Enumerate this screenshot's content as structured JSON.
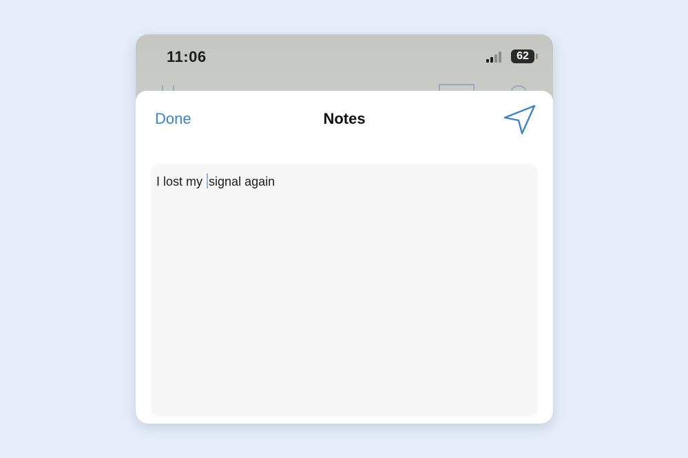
{
  "status_bar": {
    "time": "11:06",
    "battery_level": "62",
    "signal_bars_active": 2,
    "signal_bars_total": 4
  },
  "sheet": {
    "title": "Notes",
    "done_label": "Done",
    "send_icon": "send-arrow-icon"
  },
  "note": {
    "text_before_cursor": "I lost my",
    "text_after_cursor": "signal again"
  },
  "colors": {
    "accent": "#3c82c8",
    "background": "#e5eef9",
    "sheet": "#ffffff",
    "note_area": "#f7f7f7"
  }
}
